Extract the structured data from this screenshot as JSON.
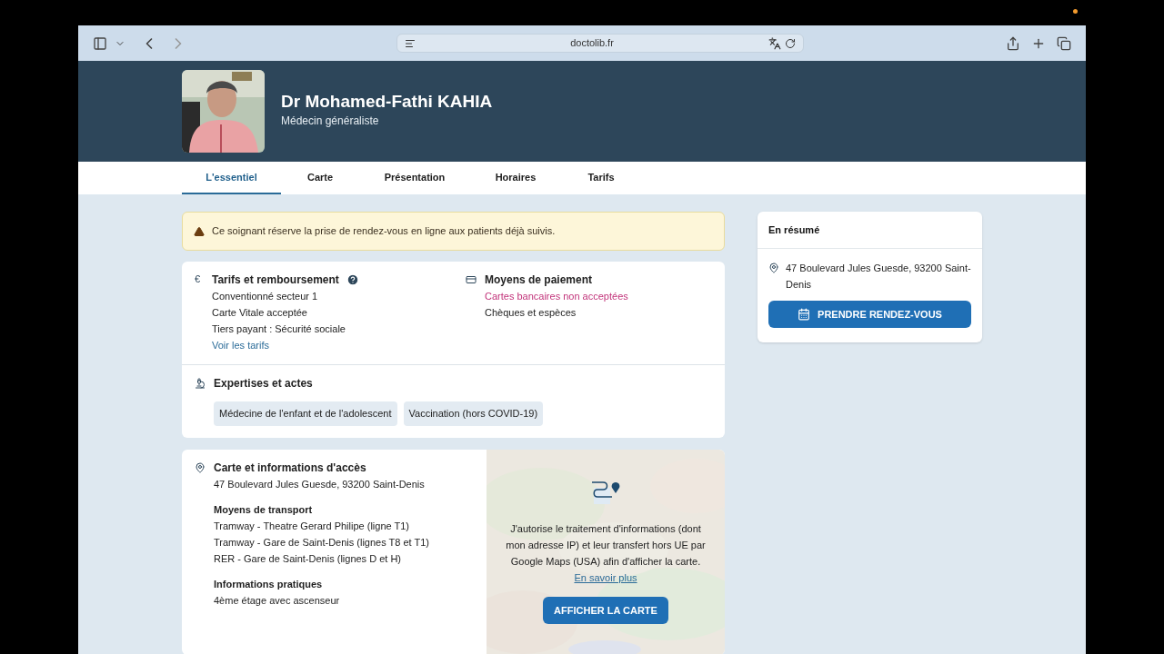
{
  "browser": {
    "url": "doctolib.fr"
  },
  "profile": {
    "name": "Dr Mohamed-Fathi KAHIA",
    "specialty": "Médecin généraliste"
  },
  "tabs": [
    {
      "label": "L'essentiel",
      "selected": true
    },
    {
      "label": "Carte",
      "selected": false
    },
    {
      "label": "Présentation",
      "selected": false
    },
    {
      "label": "Horaires",
      "selected": false
    },
    {
      "label": "Tarifs",
      "selected": false
    }
  ],
  "notice": "Ce soignant réserve la prise de rendez-vous en ligne aux patients déjà suivis.",
  "tarifs": {
    "title": "Tarifs et remboursement",
    "icon": "€",
    "lines": [
      "Conventionné secteur 1",
      "Carte Vitale acceptée",
      "Tiers payant : Sécurité sociale"
    ],
    "link": "Voir les tarifs"
  },
  "paiement": {
    "title": "Moyens de paiement",
    "lines": [
      {
        "text": "Cartes bancaires non acceptées",
        "warning": true
      },
      {
        "text": "Chèques et espèces",
        "warning": false
      }
    ]
  },
  "expertises": {
    "title": "Expertises et actes",
    "tags": [
      "Médecine de l'enfant et de l'adolescent",
      "Vaccination (hors COVID-19)"
    ]
  },
  "acces": {
    "title": "Carte et informations d'accès",
    "address": "47 Boulevard Jules Guesde, 93200 Saint-Denis",
    "sections": [
      {
        "heading": "Moyens de transport",
        "lines": [
          "Tramway - Theatre Gerard Philipe (ligne T1)",
          "Tramway - Gare de Saint-Denis (lignes T8 et T1)",
          "RER - Gare de Saint-Denis (lignes D et H)"
        ]
      },
      {
        "heading": "Informations pratiques",
        "lines": [
          "4ème étage avec ascenseur"
        ]
      }
    ],
    "consent": "J'autorise le traitement d'informations (dont mon adresse IP) et leur transfert hors UE par Google Maps (USA) afin d'afficher la carte.",
    "consent_link": "En savoir plus",
    "map_button": "AFFICHER LA CARTE"
  },
  "summary": {
    "title": "En résumé",
    "address": "47 Boulevard Jules Guesde, 93200 Saint-Denis",
    "button": "PRENDRE RENDEZ-VOUS"
  }
}
